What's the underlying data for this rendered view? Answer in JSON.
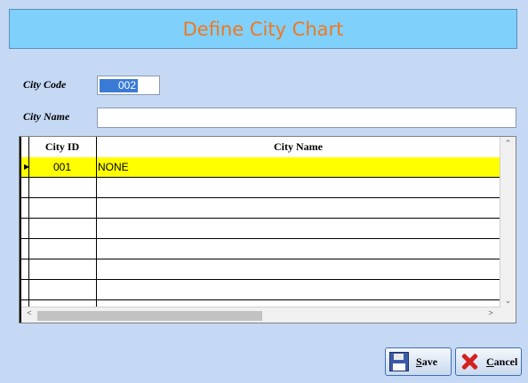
{
  "header": {
    "title": "Define City Chart"
  },
  "form": {
    "city_code_label": "City Code",
    "city_code_value": "002",
    "city_name_label": "City Name",
    "city_name_value": ""
  },
  "grid": {
    "columns": [
      "City ID",
      "City Name"
    ],
    "rows": [
      {
        "id": "001",
        "name": "NONE"
      }
    ],
    "colors": {
      "selected_row": "#ffff00"
    }
  },
  "buttons": {
    "save_mnemonic": "S",
    "save_rest": "ave",
    "cancel_mnemonic": "C",
    "cancel_rest": "ancel"
  },
  "icons": {
    "save": "floppy-disk-icon",
    "cancel": "red-x-icon"
  },
  "colors": {
    "background": "#c5d9f5",
    "header_bg": "#7fd0fb",
    "title": "#f07820"
  }
}
